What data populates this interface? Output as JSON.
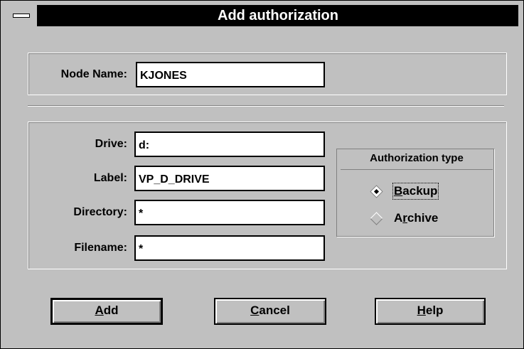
{
  "window": {
    "title": "Add authorization"
  },
  "node": {
    "label": "Node Name:",
    "value": "KJONES"
  },
  "fields": [
    {
      "label": "Drive:",
      "value": "d:"
    },
    {
      "label": "Label:",
      "value": "VP_D_DRIVE"
    },
    {
      "label": "Directory:",
      "value": "*"
    },
    {
      "label": "Filename:",
      "value": "*"
    }
  ],
  "auth_type": {
    "title": "Authorization type",
    "options": [
      {
        "mnemonic": "B",
        "rest": "ackup",
        "selected": true
      },
      {
        "pre": "A",
        "mnemonic": "r",
        "rest": "chive",
        "selected": false
      }
    ]
  },
  "buttons": {
    "add": {
      "mnemonic": "A",
      "rest": "dd"
    },
    "cancel": {
      "mnemonic": "C",
      "rest": "ancel"
    },
    "help": {
      "mnemonic": "H",
      "rest": "elp"
    }
  },
  "colors": {
    "face": "#c0c0c0",
    "title_bg": "#000000",
    "title_fg": "#ffffff"
  },
  "icons": {
    "system_menu": "system-menu-icon"
  }
}
